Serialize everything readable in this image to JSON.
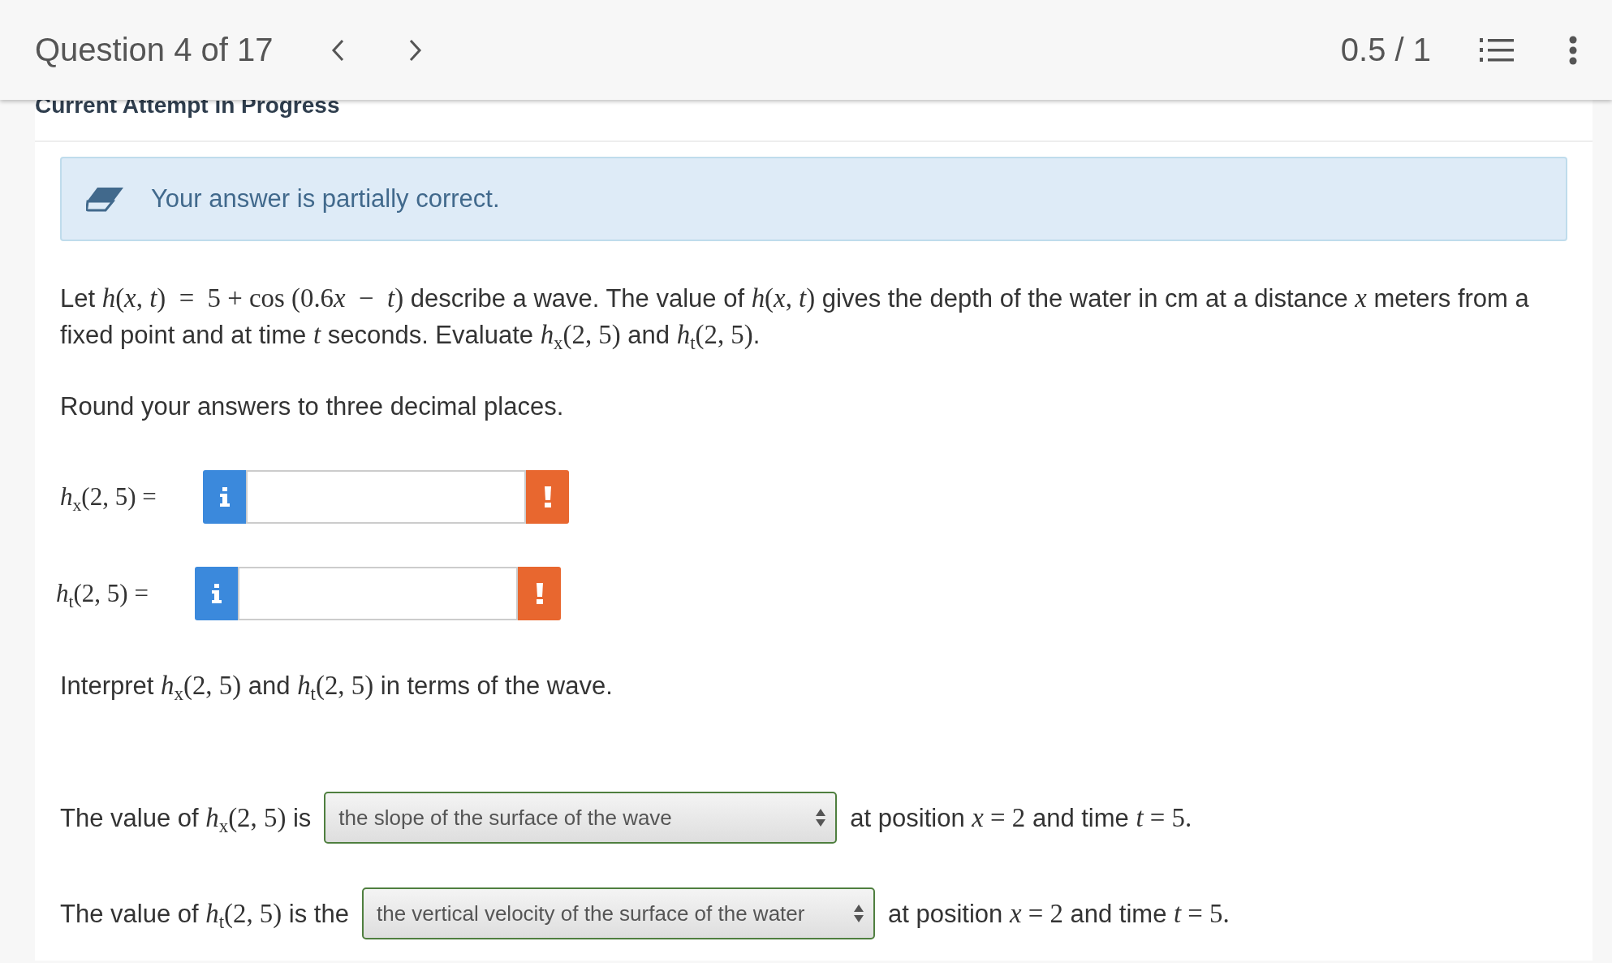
{
  "header": {
    "title": "Question 4 of 17",
    "score": "0.5 / 1"
  },
  "section_title": "Current Attempt in Progress",
  "feedback": {
    "kind": "partial",
    "message": "Your answer is partially correct."
  },
  "question": [
    {
      "kind": "text",
      "text": "Let "
    },
    {
      "kind": "math",
      "text": "*h*(*x*, *t*)  =  5 + cos (0.6"
    },
    {
      "kind": "math",
      "text": "*x*  −  *t*)"
    },
    {
      "kind": "text",
      "text": " describe a wave. The value of "
    },
    {
      "kind": "math",
      "text": "*h*(*x*, *t*)"
    },
    {
      "kind": "text",
      "text": " gives the depth of the water in cm at a distance "
    },
    {
      "kind": "math",
      "text": "*x*"
    },
    {
      "kind": "text",
      "text": " meters from a fixed point and at time "
    },
    {
      "kind": "math",
      "text": "*t*"
    },
    {
      "kind": "text",
      "text": " seconds. Evaluate "
    },
    {
      "kind": "math",
      "text": "*h*$_{x}$(2, 5)"
    },
    {
      "kind": "text",
      "text": " and "
    },
    {
      "kind": "math",
      "text": "*h*$_{t}$(2, 5)"
    },
    {
      "kind": "text",
      "text": "."
    }
  ],
  "instruction": "Round your answers to three decimal places.",
  "answers": [
    {
      "label": "*h*$_{x}$(2, 5) ="
    },
    {
      "label": "*h*$_{t}$(2, 5) ="
    }
  ],
  "interpret_prompt": [
    {
      "kind": "text",
      "text": "Interpret "
    },
    {
      "kind": "math",
      "text": "*h*$_{x}$(2, 5)"
    },
    {
      "kind": "text",
      "text": " and "
    },
    {
      "kind": "math",
      "text": "*h*$_{t}$(2, 5)"
    },
    {
      "kind": "text",
      "text": " in terms of the wave."
    }
  ],
  "interpretations": [
    {
      "prefix": [
        {
          "kind": "text",
          "text": "The value of "
        },
        {
          "kind": "math",
          "text": "*h*$_{x}$(2, 5)"
        },
        {
          "kind": "text",
          "text": " is"
        }
      ],
      "selection": "the slope of the surface of the wave",
      "correct": true,
      "suffix": [
        {
          "kind": "text",
          "text": "at position "
        },
        {
          "kind": "math",
          "text": "*x* = 2"
        },
        {
          "kind": "text",
          "text": " and time "
        },
        {
          "kind": "math",
          "text": "*t* = 5."
        }
      ]
    },
    {
      "prefix": [
        {
          "kind": "text",
          "text": "The value of "
        },
        {
          "kind": "math",
          "text": "*h*$_{t}$(2, 5)"
        },
        {
          "kind": "text",
          "text": " is the"
        }
      ],
      "selection": "the vertical velocity of the surface of the water",
      "correct": true,
      "suffix": [
        {
          "kind": "text",
          "text": "at position "
        },
        {
          "kind": "math",
          "text": "*x* = 2"
        },
        {
          "kind": "text",
          "text": " and time "
        },
        {
          "kind": "math",
          "text": "*t* = 5."
        }
      ]
    }
  ]
}
